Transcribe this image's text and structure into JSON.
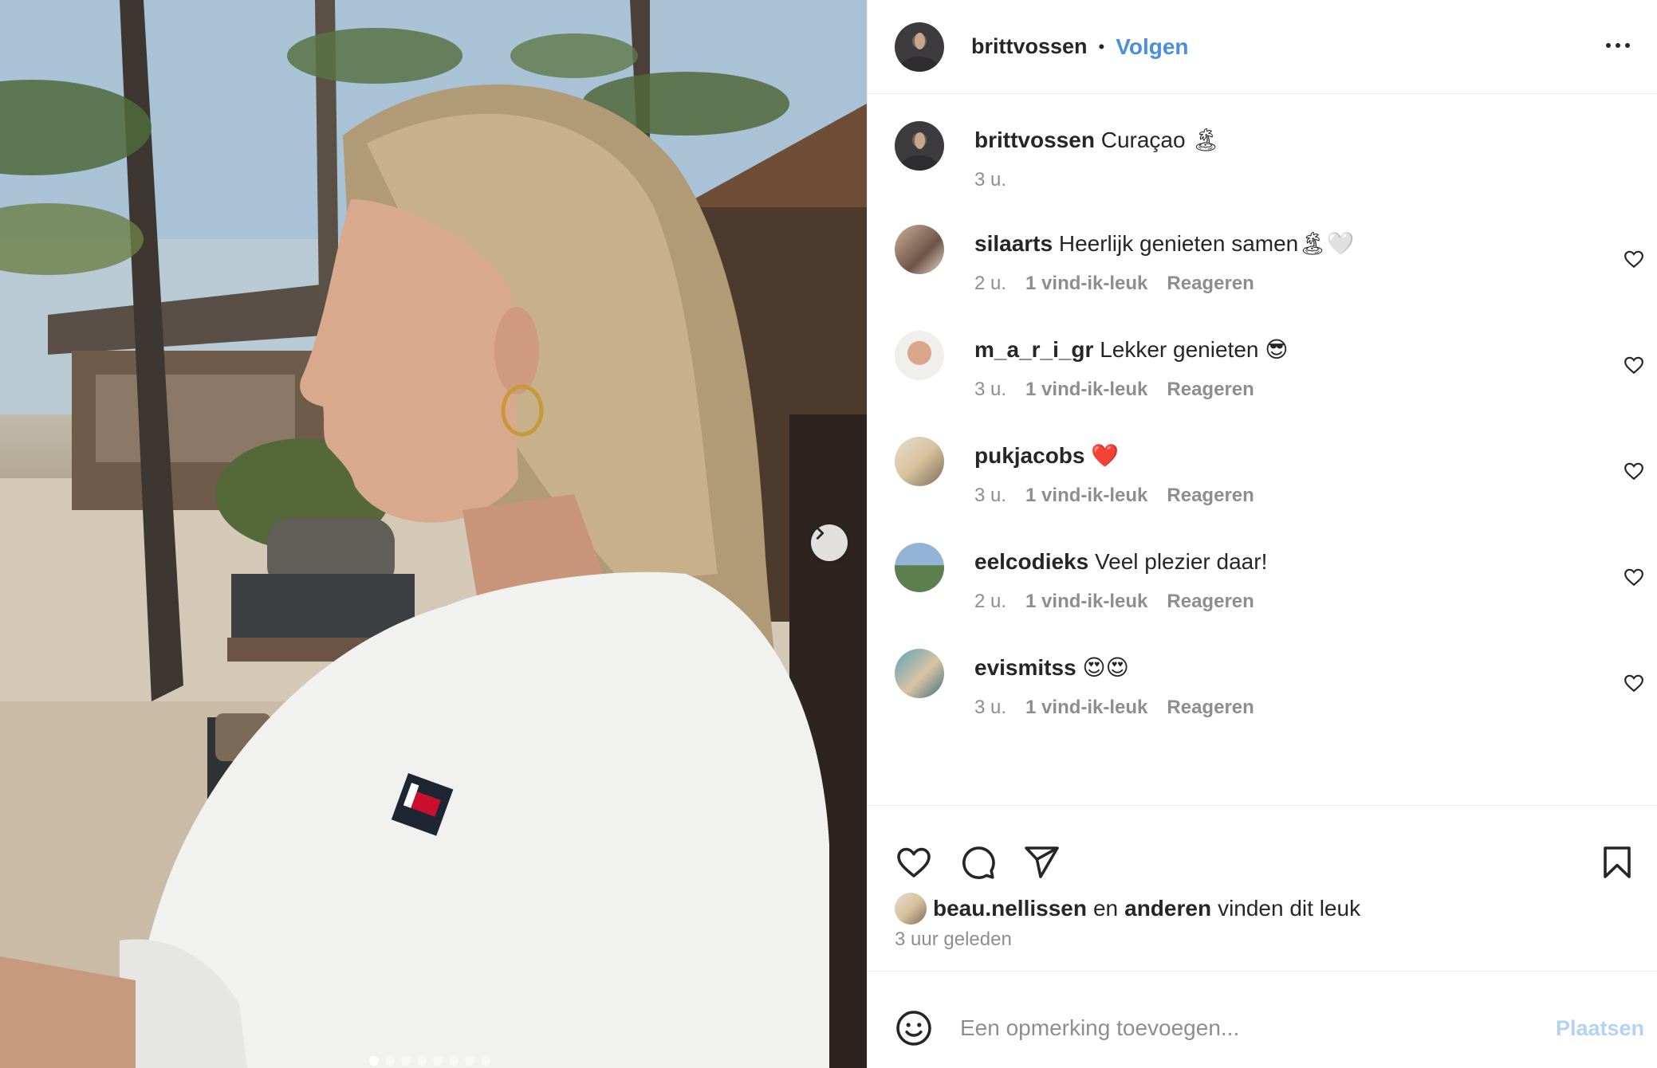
{
  "header": {
    "username": "brittvossen",
    "separator": "•",
    "follow_label": "Volgen"
  },
  "caption": {
    "username": "brittvossen",
    "text": "Curaçao 🏝",
    "time": "3 u."
  },
  "comments": [
    {
      "username": "silaarts",
      "text": "Heerlijk genieten samen🏝🤍",
      "time": "2 u.",
      "likes": "1 vind-ik-leuk",
      "reply": "Reageren"
    },
    {
      "username": "m_a_r_i_gr",
      "text": "Lekker genieten 😎",
      "time": "3 u.",
      "likes": "1 vind-ik-leuk",
      "reply": "Reageren"
    },
    {
      "username": "pukjacobs",
      "text": "❤️",
      "time": "3 u.",
      "likes": "1 vind-ik-leuk",
      "reply": "Reageren"
    },
    {
      "username": "eelcodieks",
      "text": "Veel plezier daar!",
      "time": "2 u.",
      "likes": "1 vind-ik-leuk",
      "reply": "Reageren"
    },
    {
      "username": "evismitss",
      "text": "😍😍",
      "time": "3 u.",
      "likes": "1 vind-ik-leuk",
      "reply": "Reageren"
    }
  ],
  "likes_summary": {
    "user": "beau.nellissen",
    "connector": "en",
    "others": "anderen",
    "suffix": "vinden dit leuk"
  },
  "posted_time": "3 uur geleden",
  "add_comment": {
    "placeholder": "Een opmerking toevoegen...",
    "post_label": "Plaatsen"
  },
  "carousel": {
    "total": 8,
    "current": 1
  },
  "icons": {
    "more": "more-horizontal-icon",
    "heart": "heart-icon",
    "comment": "comment-icon",
    "share": "share-icon",
    "save": "bookmark-icon",
    "emoji": "emoji-icon",
    "next": "chevron-right-icon"
  },
  "colors": {
    "accent": "#4a8fd9",
    "post_disabled": "#b3d3f4",
    "muted": "#8e8e8e"
  }
}
